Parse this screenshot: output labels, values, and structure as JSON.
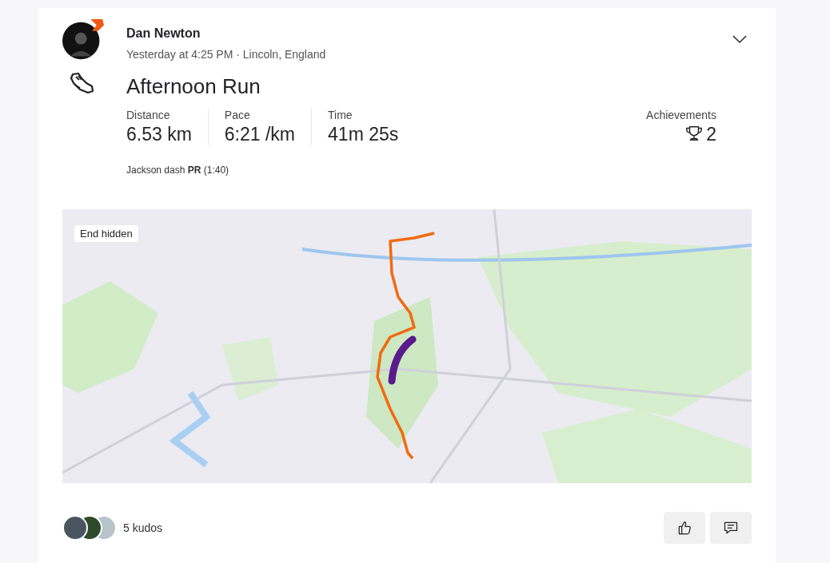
{
  "athlete": {
    "name": "Dan Newton",
    "meta": "Yesterday at 4:25 PM · Lincoln, England"
  },
  "activity": {
    "title": "Afternoon Run"
  },
  "stats": [
    {
      "label": "Distance",
      "value": "6.53 km"
    },
    {
      "label": "Pace",
      "value": "6:21 /km"
    },
    {
      "label": "Time",
      "value": "41m 25s"
    }
  ],
  "achievements": {
    "label": "Achievements",
    "count": "2"
  },
  "segment": "Jackson dash **PR** (1:40)",
  "map": {
    "badge": "End hidden"
  },
  "kudos": {
    "label": "5 kudos"
  }
}
